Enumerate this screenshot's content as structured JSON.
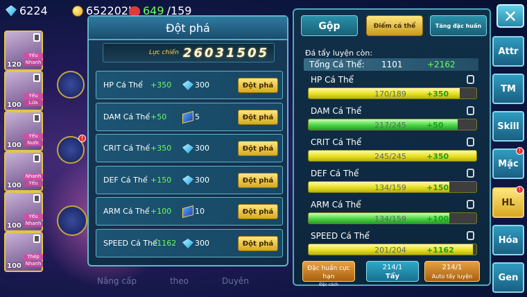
{
  "topbar": {
    "gems": "6224",
    "gold": "652202k",
    "stamina_current": "649",
    "stamina_max": "/159"
  },
  "party": [
    {
      "level": "120",
      "tag1": "Yếu",
      "tag2": "Nhanh"
    },
    {
      "level": "100",
      "tag1": "Yếu",
      "tag2": "Lửa"
    },
    {
      "level": "100",
      "tag1": "Yếu",
      "tag2": "Nước"
    },
    {
      "level": "100",
      "tag1": "Nhanh",
      "tag2": "Yếu"
    },
    {
      "level": "100",
      "tag1": "Yếu",
      "tag2": "Nhanh"
    },
    {
      "level": "100",
      "tag1": "Thép",
      "tag2": "Nhanh"
    }
  ],
  "bottom_labels": [
    "Nâng cấp",
    "theo",
    "Duyên"
  ],
  "left_panel": {
    "title": "Đột phá",
    "power_label": "Lực chiến",
    "power_value": "26031505",
    "rows": [
      {
        "name": "HP Cá Thể",
        "plus": "+350",
        "cost_icon": "gem-icon",
        "cost": "300",
        "button": "Đột phá"
      },
      {
        "name": "DAM Cá Thể",
        "plus": "+50",
        "cost_icon": "book-icon",
        "cost": "5",
        "button": "Đột phá"
      },
      {
        "name": "CRIT Cá Thể",
        "plus": "+350",
        "cost_icon": "gem-icon",
        "cost": "300",
        "button": "Đột phá"
      },
      {
        "name": "DEF Cá Thể",
        "plus": "+150",
        "cost_icon": "gem-icon",
        "cost": "300",
        "button": "Đột phá"
      },
      {
        "name": "ARM Cá Thể",
        "plus": "+100",
        "cost_icon": "book-icon",
        "cost": "10",
        "button": "Đột phá"
      },
      {
        "name": "SPEED Cá Thể",
        "plus": "+1162",
        "cost_icon": "gem-icon",
        "cost": "300",
        "button": "Đột phá"
      }
    ]
  },
  "right_panel": {
    "tabs": {
      "gop": "Gộp",
      "diem": "Điểm cá thể",
      "tang": "Tăng đặc huấn"
    },
    "remaining_label": "Đá tẩy luyện còn:",
    "total_label": "Tổng Cá Thể:",
    "total_value": "1101",
    "total_plus": "+2162",
    "stats": [
      {
        "name": "HP Cá Thể",
        "current": 170,
        "max": 189,
        "value_text": "170/189",
        "plus": "+350",
        "fill": 0.9,
        "color": "yellow"
      },
      {
        "name": "DAM Cá Thể",
        "current": 217,
        "max": 245,
        "value_text": "217/245",
        "plus": "+50",
        "fill": 0.89,
        "color": "green"
      },
      {
        "name": "CRIT Cá Thể",
        "current": 245,
        "max": 245,
        "value_text": "245/245",
        "plus": "+350",
        "fill": 1.0,
        "color": "yellow"
      },
      {
        "name": "DEF Cá Thể",
        "current": 134,
        "max": 159,
        "value_text": "134/159",
        "plus": "+150",
        "fill": 0.84,
        "color": "yellow"
      },
      {
        "name": "ARM Cá Thể",
        "current": 134,
        "max": 159,
        "value_text": "134/159",
        "plus": "+100",
        "fill": 0.84,
        "color": "green"
      },
      {
        "name": "SPEED Cá Thể",
        "current": 201,
        "max": 204,
        "value_text": "201/204",
        "plus": "+1162",
        "fill": 0.98,
        "color": "yellow"
      }
    ],
    "buttons": {
      "special_label": "Đặc huấn cực hạn",
      "special_sub": "Đặc cách",
      "wash_count": "214/1",
      "wash_label": "Tẩy",
      "auto_count": "214/1",
      "auto_label": "Auto tẩy luyện"
    }
  },
  "side_menu": [
    "Attr",
    "TM",
    "Skill",
    "Mặc",
    "HL",
    "Hóa",
    "Gen"
  ],
  "colors": {
    "accent": "#5fb7c8",
    "highlight": "#ffe680",
    "positive": "#6dff5a"
  }
}
